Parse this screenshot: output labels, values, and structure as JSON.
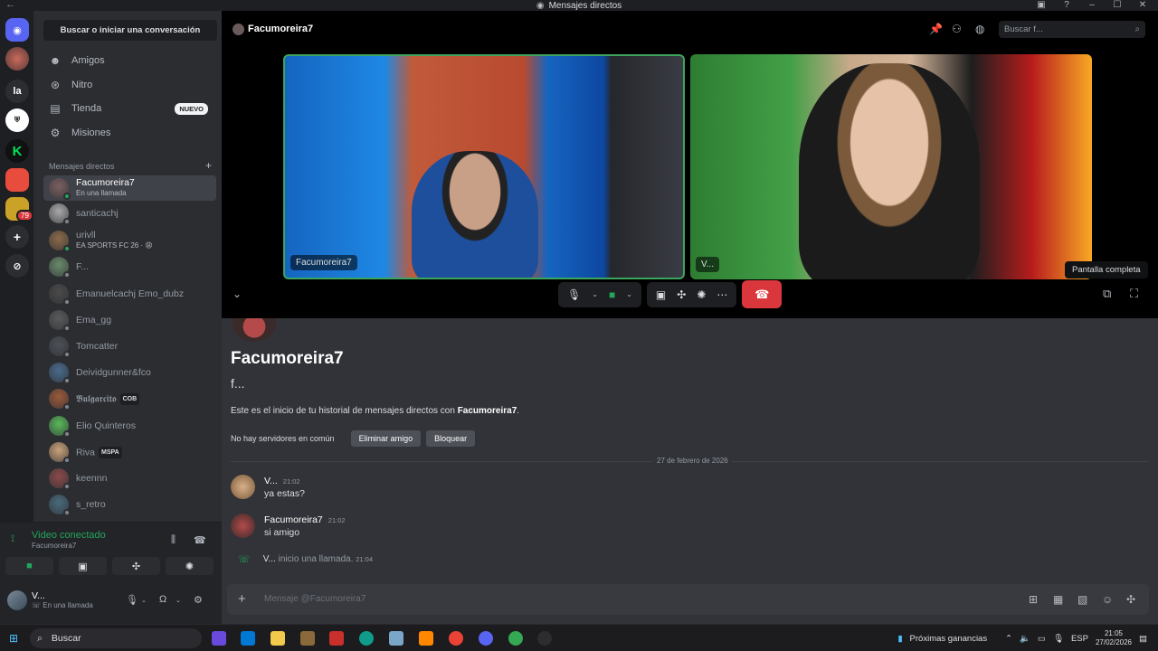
{
  "window": {
    "title": "Mensajes directos",
    "back_icon": "arrow-left-icon",
    "controls": [
      "_",
      "☐",
      "✕"
    ]
  },
  "rail": {
    "servers": [
      {
        "label": "",
        "color": "#5865f2",
        "icon": "discord-icon"
      },
      {
        "label": "",
        "color": "#8a5a5a"
      },
      {
        "label": "la",
        "color": "#2b2d31"
      },
      {
        "label": "",
        "color": "#ffffff"
      },
      {
        "label": "K",
        "color": "#00e05a"
      },
      {
        "label": "",
        "color": "#e74c3c"
      },
      {
        "label": "",
        "color": "#c9a227"
      }
    ],
    "badge": "79",
    "add_icon": "plus-icon",
    "discover_icon": "compass-icon"
  },
  "sidebar": {
    "search_label": "Buscar o iniciar una conversación",
    "nav": [
      {
        "label": "Amigos",
        "icon": "person-wave-icon"
      },
      {
        "label": "Nitro",
        "icon": "nitro-icon"
      },
      {
        "label": "Tienda",
        "icon": "shop-icon",
        "badge": "NUEVO"
      },
      {
        "label": "Misiones",
        "icon": "quest-icon"
      }
    ],
    "dm_header": "Mensajes directos",
    "dms": [
      {
        "name": "Facumoreira7",
        "sub": "En una llamada",
        "active": true,
        "color": "#7a6060",
        "online": true
      },
      {
        "name": "santicachj",
        "sub": "",
        "active": false,
        "color": "#a8a8a8",
        "online": false
      },
      {
        "name": "urivll",
        "sub": "EA SPORTS FC 26 · 😩",
        "active": false,
        "color": "#8a6a4a",
        "online": true
      },
      {
        "name": "F...",
        "sub": "",
        "active": false,
        "color": "#6a8a6a",
        "online": false
      },
      {
        "name": "Emanuelcachj Emo_dubz",
        "sub": "",
        "active": false,
        "color": "#4a4a4a",
        "online": false
      },
      {
        "name": "Ema_gg",
        "sub": "",
        "active": false,
        "color": "#5a5a5a",
        "online": false
      },
      {
        "name": "Tomcatter",
        "sub": "",
        "active": false,
        "color": "#4e5058",
        "online": false
      },
      {
        "name": "Deividgunner&fco",
        "sub": "",
        "active": false,
        "color": "#4a6a8a",
        "online": false
      },
      {
        "name": "𝕭𝖚𝖑𝖌𝖆𝖗𝖈𝖎𝖙𝖔",
        "sub": "",
        "tag": "COB",
        "active": false,
        "color": "#9a5a3a",
        "online": false
      },
      {
        "name": "Elio Quinteros",
        "sub": "",
        "active": false,
        "color": "#5ab85a",
        "online": false
      },
      {
        "name": "Riva",
        "sub": "",
        "tag": "MSPA",
        "active": false,
        "color": "#c9a27a",
        "online": false
      },
      {
        "name": "keennn",
        "sub": "",
        "active": false,
        "color": "#8a4a4a",
        "online": false
      },
      {
        "name": "s_retro",
        "sub": "",
        "active": false,
        "color": "#4a6a7a",
        "online": false
      }
    ]
  },
  "voice": {
    "title": "Video conectado",
    "channel": "Facumoreira7",
    "buttons": [
      "camera-icon",
      "screen-share-icon",
      "activities-icon",
      "soundboard-icon"
    ]
  },
  "user": {
    "name": "V...",
    "status": "En una llamada"
  },
  "header": {
    "name": "Facumoreira7",
    "search_placeholder": "Buscar f..."
  },
  "call": {
    "tiles": [
      {
        "label": "Facumoreira7"
      },
      {
        "label": "V..."
      }
    ],
    "tooltip": "Pantalla completa"
  },
  "chat": {
    "name": "Facumoreira7",
    "username": "f...",
    "intro_prefix": "Este es el inicio de tu historial de mensajes directos con ",
    "intro_name": "Facumoreira7",
    "intro_suffix": ".",
    "no_servers": "No hay servidores en común",
    "remove_friend": "Eliminar amigo",
    "block": "Bloquear",
    "date_divider": "27 de febrero de 2026",
    "messages": [
      {
        "author": "V...",
        "time": "21:02",
        "text": "ya estas?",
        "color": "#c99a6a"
      },
      {
        "author": "Facumoreira7",
        "time": "21:02",
        "text": "si amigo",
        "color": "#8a4a4a"
      }
    ],
    "system": {
      "author": "V...",
      "text": "inicio una llamada.",
      "time": "21:04"
    },
    "composer_placeholder": "Mensaje @Facumoreira7"
  },
  "taskbar": {
    "search": "Buscar",
    "widget": "Próximas ganancias",
    "lang": "ESP",
    "time": "21:05",
    "date": "27/02/2026"
  }
}
